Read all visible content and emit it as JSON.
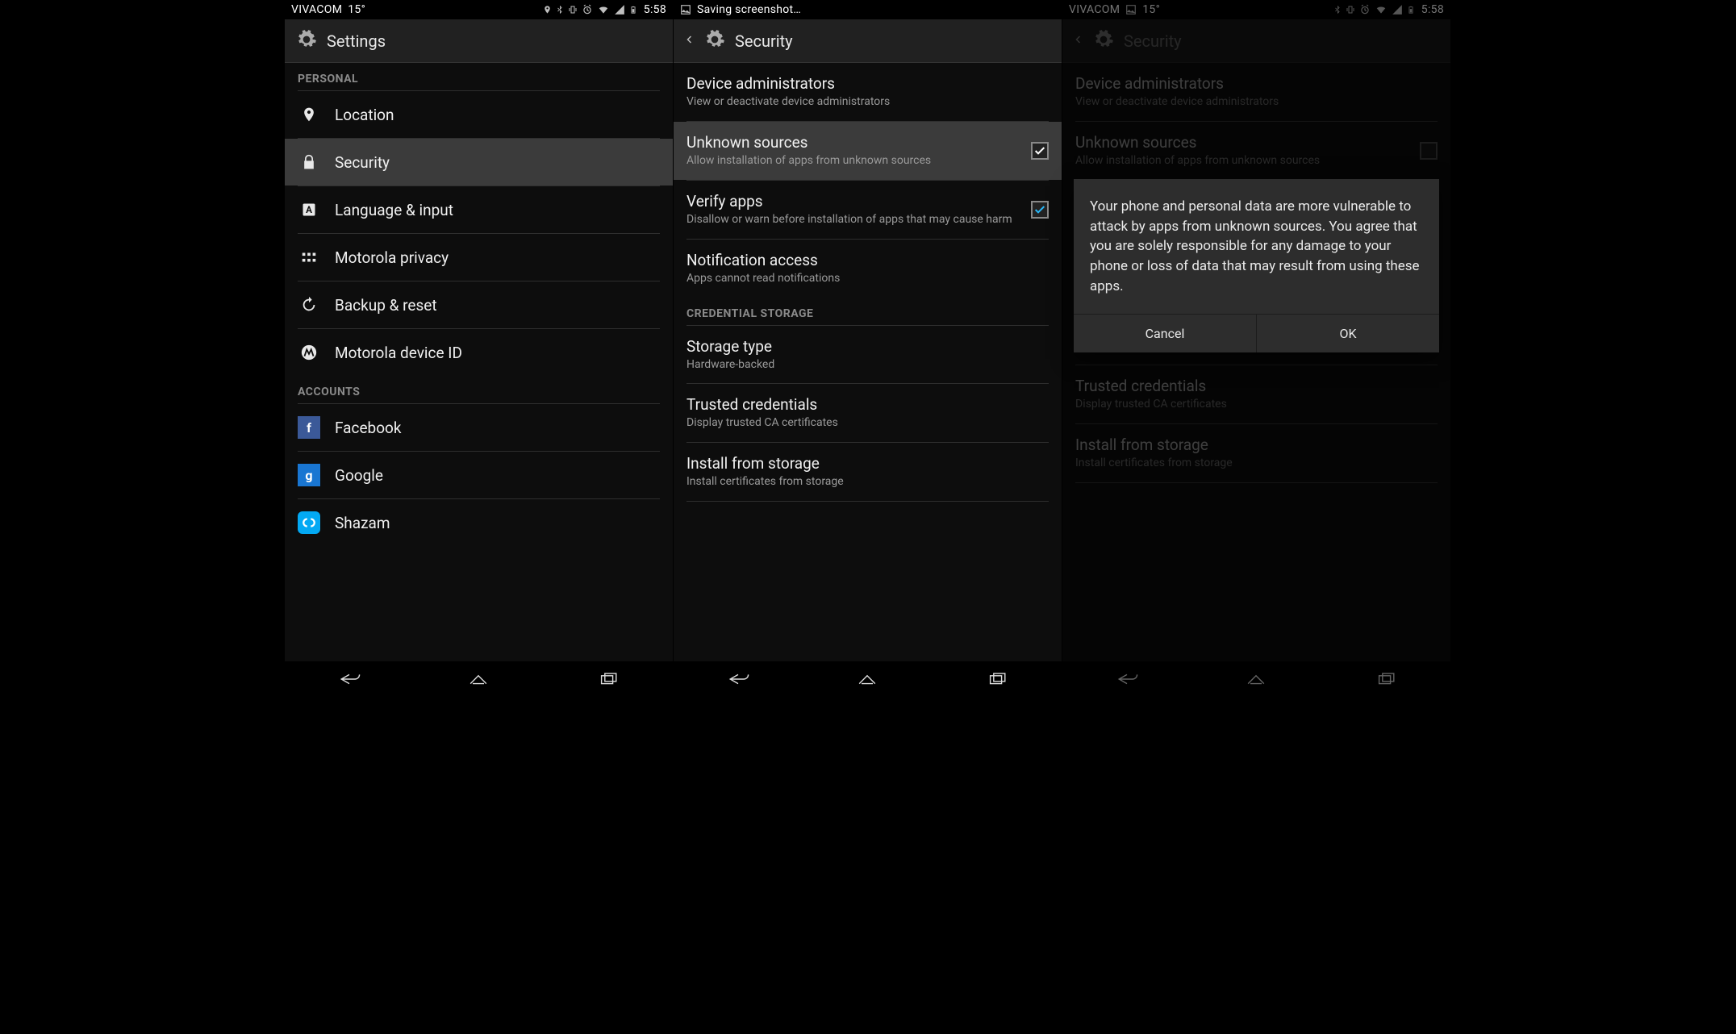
{
  "status": {
    "carrier": "VIVACOM",
    "temp": "15°",
    "time": "5:58",
    "screenshot": "Saving screenshot…"
  },
  "p1": {
    "title": "Settings",
    "sec_personal": "PERSONAL",
    "sec_accounts": "ACCOUNTS",
    "items": {
      "location": "Location",
      "security": "Security",
      "language": "Language & input",
      "moto_privacy": "Motorola privacy",
      "backup": "Backup & reset",
      "moto_id": "Motorola device ID"
    },
    "accounts": {
      "facebook": "Facebook",
      "google": "Google",
      "shazam": "Shazam"
    }
  },
  "p2": {
    "title": "Security",
    "items": {
      "dev_admin_t": "Device administrators",
      "dev_admin_s": "View or deactivate device administrators",
      "unknown_t": "Unknown sources",
      "unknown_s": "Allow installation of apps from unknown sources",
      "verify_t": "Verify apps",
      "verify_s": "Disallow or warn before installation of apps that may cause harm",
      "notif_t": "Notification access",
      "notif_s": "Apps cannot read notifications",
      "sec_cred": "CREDENTIAL STORAGE",
      "storage_t": "Storage type",
      "storage_s": "Hardware-backed",
      "trusted_t": "Trusted credentials",
      "trusted_s": "Display trusted CA certificates",
      "install_t": "Install from storage",
      "install_s": "Install certificates from storage"
    }
  },
  "p3": {
    "dialog_body": "Your phone and personal data are more vulnerable to attack by apps from unknown sources. You agree that you are solely responsible for any damage to your phone or loss of data that may result from using these apps.",
    "cancel": "Cancel",
    "ok": "OK"
  }
}
